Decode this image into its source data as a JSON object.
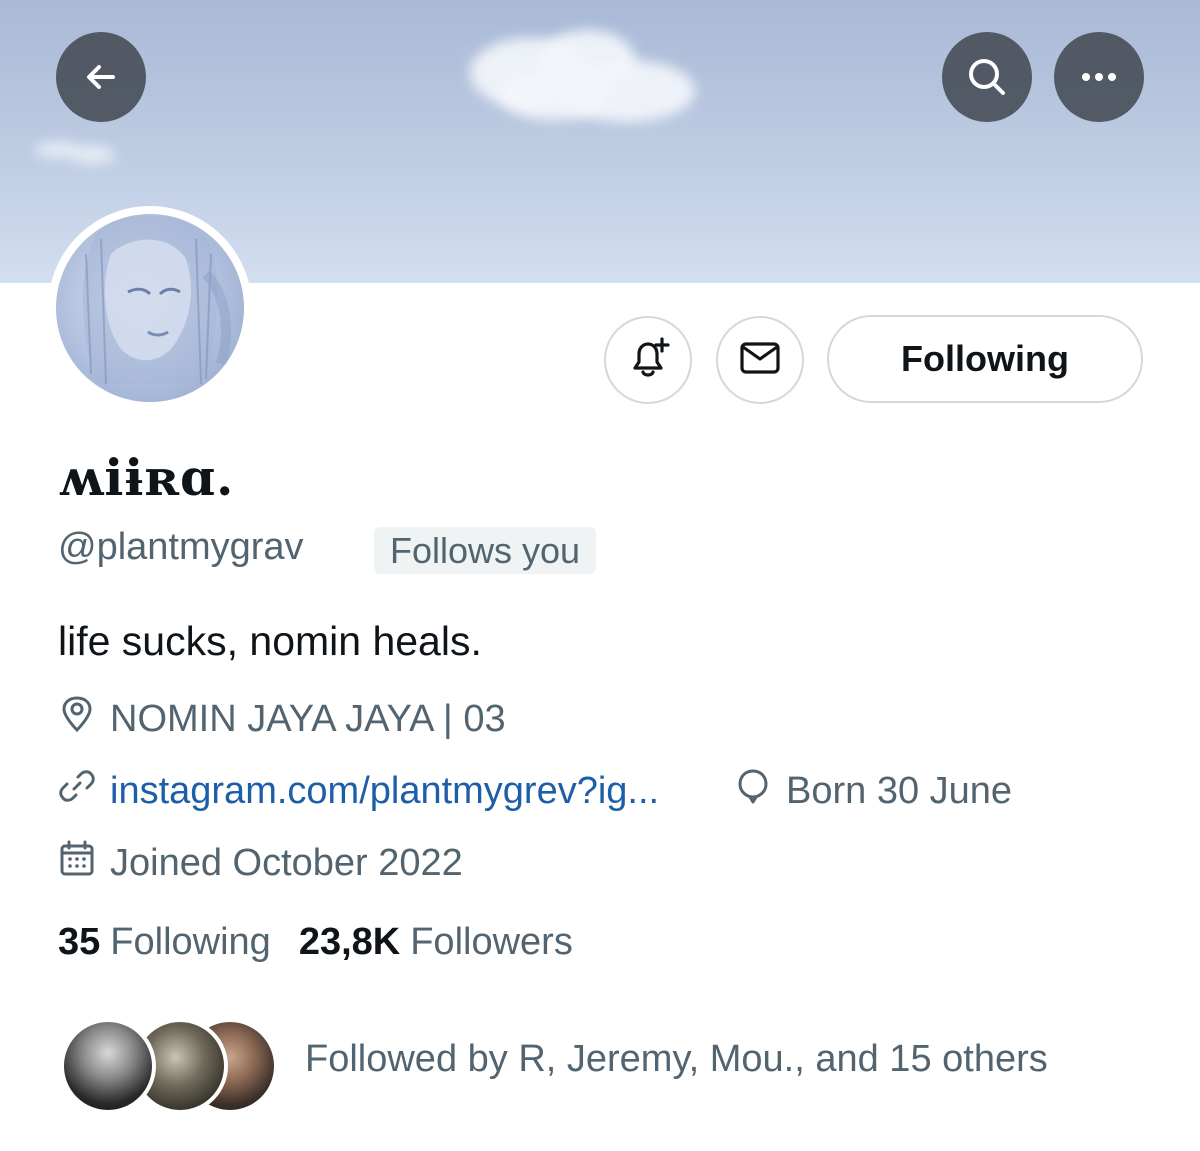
{
  "header": {
    "back_icon": "arrow-left-icon",
    "search_icon": "search-icon",
    "more_icon": "more-horizontal-icon"
  },
  "profile": {
    "display_name": "ʍiɨʀɑ.",
    "handle": "@plantmygrav",
    "follows_you_badge": "Follows you",
    "bio": "life sucks, nomin heals.",
    "location": "NOMIN JAYA JAYA | 03",
    "website": "instagram.com/plantmygrev?ig...",
    "birthday": "Born 30 June",
    "joined": "Joined October 2022"
  },
  "actions": {
    "notify_icon": "bell-plus-icon",
    "message_icon": "envelope-icon",
    "following_label": "Following"
  },
  "stats": {
    "following_count": "35",
    "following_label": "Following",
    "followers_count": "23,8K",
    "followers_label": "Followers"
  },
  "followed_by": {
    "text": "Followed by R, Jeremy, Mou., and 15 others"
  },
  "colors": {
    "link": "#1d5ea8",
    "secondary_text": "#536471",
    "primary_text": "#0f1419",
    "button_border": "#cfd9de",
    "badge_bg": "#eff3f4"
  }
}
